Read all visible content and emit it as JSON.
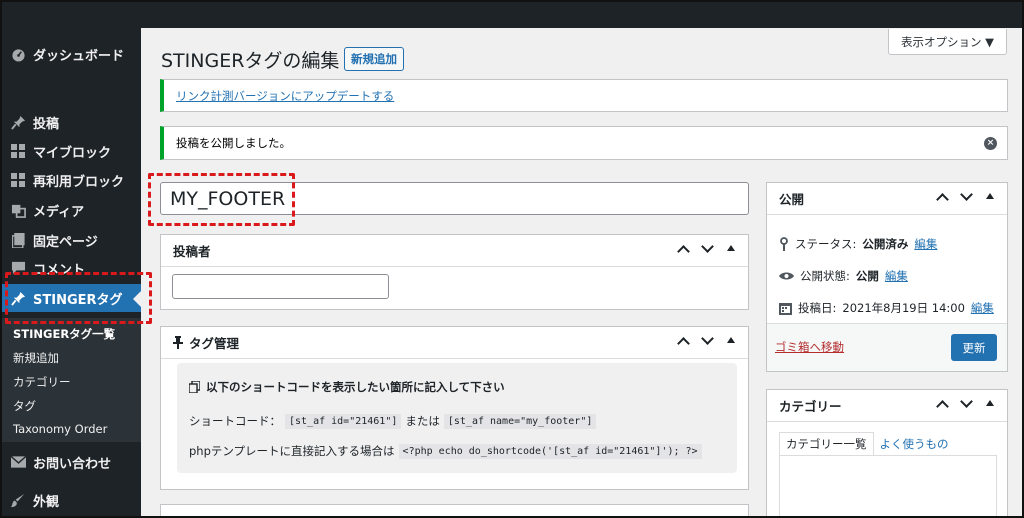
{
  "sidebar": {
    "items": [
      {
        "label": "ダッシュボード",
        "icon": "dashboard-icon"
      },
      {
        "label": "投稿",
        "icon": "pin-icon"
      },
      {
        "label": "マイブロック",
        "icon": "grid-icon"
      },
      {
        "label": "再利用ブロック",
        "icon": "grid-icon"
      },
      {
        "label": "メディア",
        "icon": "media-icon"
      },
      {
        "label": "固定ページ",
        "icon": "page-icon"
      },
      {
        "label": "コメント",
        "icon": "comment-icon"
      },
      {
        "label": "STINGERタグ",
        "icon": "pin-icon"
      },
      {
        "label": "お問い合わせ",
        "icon": "mail-icon"
      },
      {
        "label": "外観",
        "icon": "appearance-icon"
      }
    ],
    "submenu": [
      "STINGERタグ一覧",
      "新規追加",
      "カテゴリー",
      "タグ",
      "Taxonomy Order"
    ]
  },
  "header": {
    "title": "STINGERタグの編集",
    "add_new": "新規追加",
    "screen_options": "表示オプション ▼"
  },
  "notices": {
    "update_link": "リンク計測バージョンにアップデートする",
    "published": "投稿を公開しました。"
  },
  "post": {
    "title_value": "MY_FOOTER"
  },
  "author_box": {
    "title": "投稿者",
    "value": ""
  },
  "tag_box": {
    "title": "タグ管理",
    "instruction": "以下のショートコードを表示したい箇所に記入して下さい",
    "shortcode_label": "ショートコード：",
    "code_id": "[st_af id=\"21461\"]",
    "or_text": "または",
    "code_name": "[st_af name=\"my_footer\"]",
    "php_label": "phpテンプレートに直接記入する場合は",
    "php_code": "<?php echo do_shortcode('[st_af id=\"21461\"]'); ?>"
  },
  "publish_box": {
    "title": "公開",
    "status_label": "ステータス:",
    "status_value": "公開済み",
    "visibility_label": "公開状態:",
    "visibility_value": "公開",
    "date_label": "投稿日:",
    "date_value": "2021年8月19日 14:00",
    "edit": "編集",
    "trash": "ゴミ箱へ移動",
    "update": "更新"
  },
  "category_box": {
    "title": "カテゴリー",
    "tab_all": "カテゴリー一覧",
    "tab_popular": "よく使うもの"
  },
  "colors": {
    "sidebar_bg": "#1d2327",
    "accent": "#2271b1",
    "highlight_dash": "#d9191c",
    "notice_border": "#00a32a"
  }
}
